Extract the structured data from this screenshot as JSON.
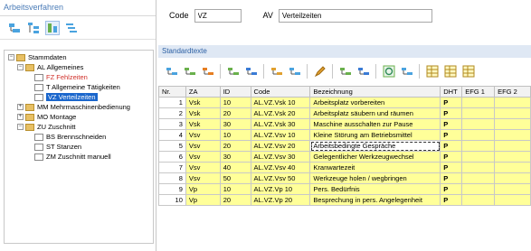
{
  "left_panel": {
    "title": "Arbeitsverfahren",
    "toolbar": [
      {
        "icon": "new-icon"
      },
      {
        "icon": "tree-add-icon"
      },
      {
        "icon": "sort-icon",
        "active": true
      },
      {
        "icon": "filter-icon"
      }
    ],
    "tree": [
      {
        "label": "Stammdaten",
        "level": 0,
        "toggle": "−",
        "icon": "folder",
        "style": ""
      },
      {
        "label": "AL Allgemeines",
        "level": 1,
        "toggle": "−",
        "icon": "folder",
        "style": ""
      },
      {
        "label": "FZ Fehlzeiten",
        "level": 2,
        "toggle": "",
        "icon": "doc",
        "style": "red"
      },
      {
        "label": "T Allgemeine Tätigkeiten",
        "level": 2,
        "toggle": "",
        "icon": "doc",
        "style": ""
      },
      {
        "label": "VZ Verteilzeiten",
        "level": 2,
        "toggle": "",
        "icon": "doc",
        "style": "selected"
      },
      {
        "label": "MM Mehrmaschinenbedienung",
        "level": 1,
        "toggle": "+",
        "icon": "folder",
        "style": ""
      },
      {
        "label": "MO Montage",
        "level": 1,
        "toggle": "+",
        "icon": "folder",
        "style": ""
      },
      {
        "label": "ZU Zuschnitt",
        "level": 1,
        "toggle": "−",
        "icon": "folder",
        "style": ""
      },
      {
        "label": "BS Brennschneiden",
        "level": 2,
        "toggle": "",
        "icon": "doc",
        "style": ""
      },
      {
        "label": "ST Stanzen",
        "level": 2,
        "toggle": "",
        "icon": "doc",
        "style": ""
      },
      {
        "label": "ZM Zuschnitt manuell",
        "level": 2,
        "toggle": "",
        "icon": "doc",
        "style": ""
      }
    ]
  },
  "header": {
    "code_label": "Code",
    "code_value": "VZ",
    "av_label": "AV",
    "av_value": "Verteilzeiten"
  },
  "standardtexte": {
    "title": "Standardtexte",
    "toolbar": [
      "insert-row-icon",
      "insert-above-icon",
      "insert-below-icon",
      "sep",
      "move-left-icon",
      "add-icon",
      "sep",
      "list-icon",
      "list-alt-icon",
      "sep",
      "pencil-icon",
      "sep",
      "move-up-icon",
      "move-down-icon",
      "sep",
      "refresh-icon",
      "columns-icon",
      "sep",
      "grid-icon",
      "grid-alt-icon",
      "grid-edit-icon"
    ],
    "columns": [
      "Nr.",
      "ZA",
      "ID",
      "Code",
      "Bezeichnung",
      "DHT",
      "EFG 1",
      "EFG 2"
    ],
    "rows": [
      {
        "nr": "1",
        "za": "Vsk",
        "id": "10",
        "code": "AL.VZ.Vsk 10",
        "bez": "Arbeitsplatz vorbereiten",
        "dht": "P",
        "efg1": "",
        "efg2": ""
      },
      {
        "nr": "2",
        "za": "Vsk",
        "id": "20",
        "code": "AL.VZ.Vsk 20",
        "bez": "Arbeitsplatz säubern und räumen",
        "dht": "P",
        "efg1": "",
        "efg2": ""
      },
      {
        "nr": "3",
        "za": "Vsk",
        "id": "30",
        "code": "AL.VZ.Vsk 30",
        "bez": "Maschine ausschalten zur Pause",
        "dht": "P",
        "efg1": "",
        "efg2": ""
      },
      {
        "nr": "4",
        "za": "Vsv",
        "id": "10",
        "code": "AL.VZ.Vsv 10",
        "bez": "Kleine Störung am Betriebsmittel",
        "dht": "P",
        "efg1": "",
        "efg2": ""
      },
      {
        "nr": "5",
        "za": "Vsv",
        "id": "20",
        "code": "AL.VZ.Vsv 20",
        "bez": "Arbeitsbedingte Gespräche",
        "dht": "P",
        "efg1": "",
        "efg2": "",
        "editing": true
      },
      {
        "nr": "6",
        "za": "Vsv",
        "id": "30",
        "code": "AL.VZ.Vsv 30",
        "bez": "Gelegentlicher Werkzeugwechsel",
        "dht": "P",
        "efg1": "",
        "efg2": ""
      },
      {
        "nr": "7",
        "za": "Vsv",
        "id": "40",
        "code": "AL.VZ.Vsv 40",
        "bez": "Kranwartezeit",
        "dht": "P",
        "efg1": "",
        "efg2": ""
      },
      {
        "nr": "8",
        "za": "Vsv",
        "id": "50",
        "code": "AL.VZ.Vsv 50",
        "bez": "Werkzeuge holen / wegbringen",
        "dht": "P",
        "efg1": "",
        "efg2": ""
      },
      {
        "nr": "9",
        "za": "Vp",
        "id": "10",
        "code": "AL.VZ.Vp 10",
        "bez": "Pers. Bedürfnis",
        "dht": "P",
        "efg1": "",
        "efg2": ""
      },
      {
        "nr": "10",
        "za": "Vp",
        "id": "20",
        "code": "AL.VZ.Vp 20",
        "bez": "Besprechung in pers. Angelegenheit",
        "dht": "P",
        "efg1": "",
        "efg2": ""
      }
    ]
  },
  "colors": {
    "row_fill": "#ffff99",
    "selected_fill": "#1a66cc",
    "header_blue": "#4a7bb7"
  }
}
